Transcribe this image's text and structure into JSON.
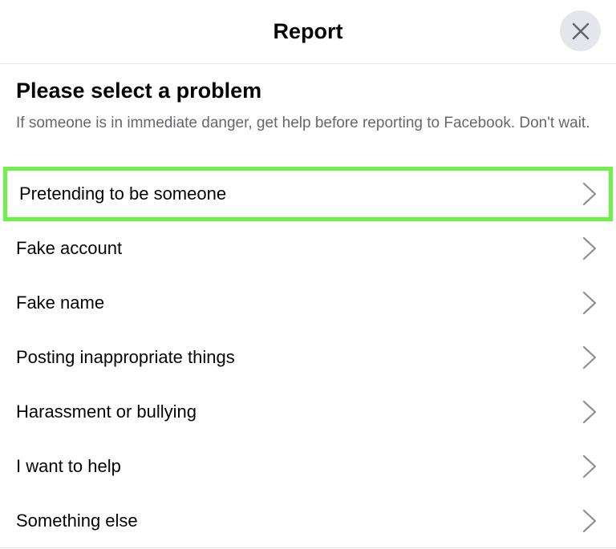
{
  "header": {
    "title": "Report",
    "close_icon": "close-icon"
  },
  "intro": {
    "heading": "Please select a problem",
    "note": "If someone is in immediate danger, get help before reporting to Facebook. Don't wait."
  },
  "options": [
    {
      "label": "Pretending to be someone",
      "highlighted": true,
      "icon": "chevron-right-icon"
    },
    {
      "label": "Fake account",
      "highlighted": false,
      "icon": "chevron-right-icon"
    },
    {
      "label": "Fake name",
      "highlighted": false,
      "icon": "chevron-right-icon"
    },
    {
      "label": "Posting inappropriate things",
      "highlighted": false,
      "icon": "chevron-right-icon"
    },
    {
      "label": "Harassment or bullying",
      "highlighted": false,
      "icon": "chevron-right-icon"
    },
    {
      "label": "I want to help",
      "highlighted": false,
      "icon": "chevron-right-icon"
    },
    {
      "label": "Something else",
      "highlighted": false,
      "icon": "chevron-right-icon"
    }
  ],
  "colors": {
    "highlight": "#6ef24a",
    "close_button_bg": "#e4e6eb",
    "secondary_text": "#65676b"
  }
}
